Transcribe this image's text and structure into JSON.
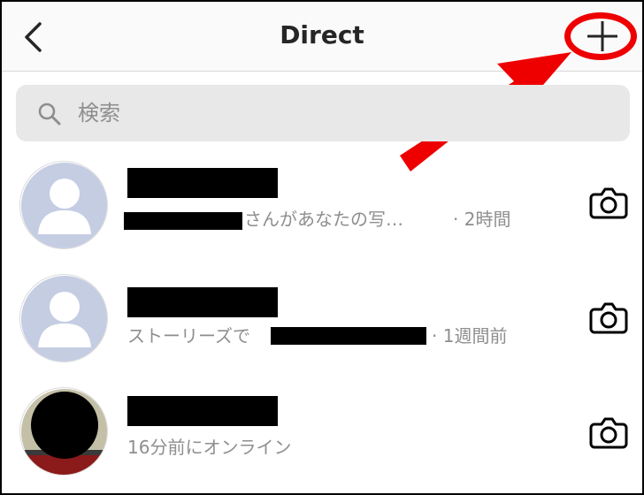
{
  "header": {
    "title": "Direct",
    "back_icon": "chevron-left-icon",
    "new_message_icon": "plus-icon"
  },
  "search": {
    "placeholder": "検索",
    "icon": "search-icon"
  },
  "conversations": [
    {
      "name": "",
      "message_visible_start": "",
      "message_visible_end": "さんがあなたの写…",
      "time": "· 2時間",
      "action_icon": "camera-icon"
    },
    {
      "name": "",
      "message_visible_start": "ストーリーズで",
      "message_visible_end": "",
      "time": "· 1週間前",
      "action_icon": "camera-icon"
    },
    {
      "name": "",
      "message_visible_start": "16分前にオンライン",
      "message_visible_end": "",
      "time": "",
      "action_icon": "camera-icon"
    }
  ],
  "annotation": {
    "ring_color": "#ee0000",
    "arrow_color": "#ee0000"
  }
}
